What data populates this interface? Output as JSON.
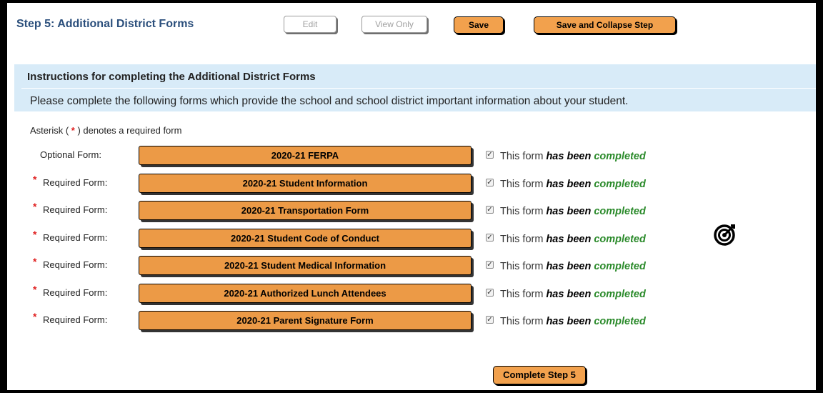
{
  "header": {
    "step_title": "Step 5: Additional District Forms",
    "edit_label": "Edit",
    "view_only_label": "View Only",
    "save_label": "Save",
    "save_collapse_label": "Save and Collapse Step"
  },
  "instructions": {
    "title": "Instructions for completing the Additional District Forms",
    "text": "Please complete the following forms which provide the school and school district important information about your student."
  },
  "asterisk_note": {
    "prefix": "Asterisk (",
    "star": "*",
    "suffix": ") denotes a required form"
  },
  "status_text": {
    "prefix": "This form ",
    "has_been": "has been",
    "completed": "completed"
  },
  "forms": [
    {
      "label": "Optional Form:",
      "required": false,
      "name": "2020-21 FERPA",
      "checked": true
    },
    {
      "label": "Required Form:",
      "required": true,
      "name": "2020-21 Student Information",
      "checked": true
    },
    {
      "label": "Required Form:",
      "required": true,
      "name": "2020-21 Transportation Form",
      "checked": true
    },
    {
      "label": "Required Form:",
      "required": true,
      "name": "2020-21 Student Code of Conduct",
      "checked": true
    },
    {
      "label": "Required Form:",
      "required": true,
      "name": "2020-21 Student Medical Information",
      "checked": true
    },
    {
      "label": "Required Form:",
      "required": true,
      "name": "2020-21 Authorized Lunch Attendees",
      "checked": true
    },
    {
      "label": "Required Form:",
      "required": true,
      "name": "2020-21 Parent Signature Form",
      "checked": true
    }
  ],
  "complete_button_label": "Complete Step 5",
  "icons": {
    "target": "target-icon",
    "checkbox": "check-icon"
  },
  "colors": {
    "accent": "#ec9a46",
    "instructions_bg": "#d8ebf8",
    "title": "#2b4f7c",
    "completed": "#2a8a2a",
    "required_star": "#e02020"
  }
}
